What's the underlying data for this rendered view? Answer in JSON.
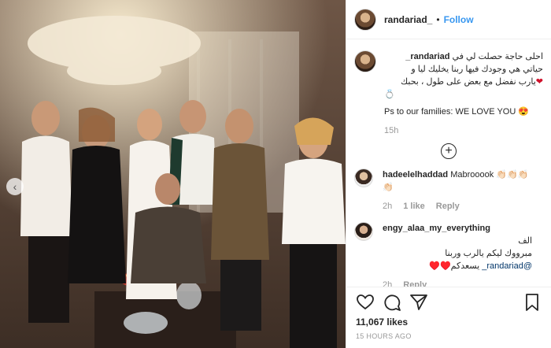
{
  "post": {
    "username": "randariad_",
    "follow_label": "Follow",
    "dot": "•",
    "caption": {
      "username": "randariad_",
      "line1": "احلى حاجة حصلت لي في",
      "line2": "حياتي هي وجودك فيها ربنا يخليك ليا و",
      "line3": "يارب نفضل مع بعض على طول ، بحبك",
      "emoji_heart": "❤",
      "emoji_ring": "💍",
      "line4": "Ps to our families: WE LOVE YOU 😍",
      "time": "15h"
    },
    "comments": [
      {
        "username": "hadeelelhaddad",
        "text": "Mabrooook 👏🏻👏🏻👏🏻👏🏻",
        "time": "2h",
        "likes": "1 like",
        "reply": "Reply"
      },
      {
        "username": "engy_alaa_my_everything",
        "text_rtl1": "الف",
        "text_rtl2": "مبرووك ليكم يالرب وربنا",
        "text_rtl3": "يسعدكم♥️♥️",
        "mention": "@randariad_",
        "time": "2h",
        "reply": "Reply"
      }
    ],
    "likes_count": "11,067 likes",
    "timestamp": "15 HOURS AGO",
    "icons": [
      "heart-icon",
      "comment-icon",
      "share-icon",
      "bookmark-icon",
      "plus-circle-icon",
      "chevron-left-icon"
    ]
  }
}
